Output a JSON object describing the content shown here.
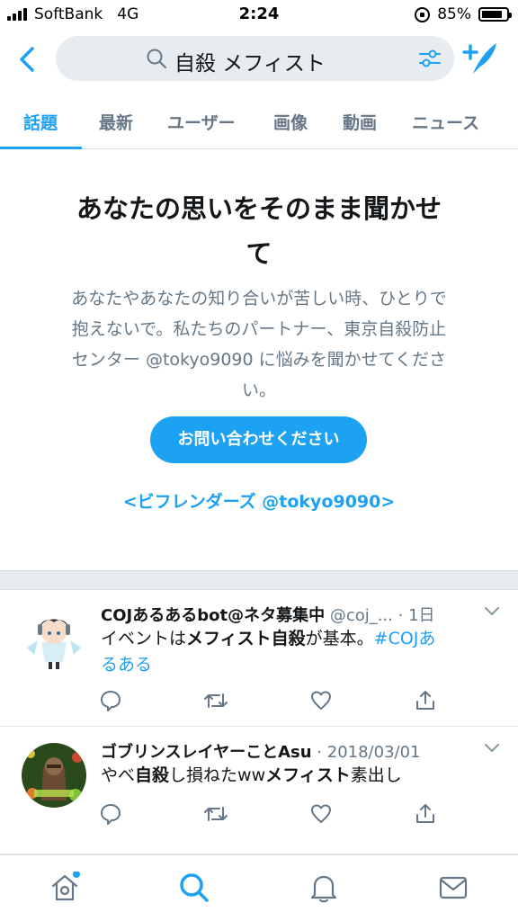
{
  "status_bar": {
    "carrier": "SoftBank",
    "network": "4G",
    "time": "2:24",
    "battery": "85%",
    "battery_level": 0.85
  },
  "search": {
    "query": "自殺 メフィスト",
    "search_icon": "search-icon",
    "filter_icon": "filter-icon"
  },
  "header": {
    "back_icon": "chevron-left-icon",
    "compose_icon": "compose-icon"
  },
  "tabs": [
    {
      "label": "話題",
      "active": true
    },
    {
      "label": "最新",
      "active": false
    },
    {
      "label": "ユーザー",
      "active": false
    },
    {
      "label": "画像",
      "active": false
    },
    {
      "label": "動画",
      "active": false
    },
    {
      "label": "ニュース",
      "active": false
    }
  ],
  "prompt": {
    "title_line1": "あなたの思いをそのまま聞かせ",
    "title_line2": "て",
    "body_line1": "あなたやあなたの知り合いが苦しい時、ひとりで",
    "body_line2": "抱えないで。私たちのパートナー、東京自殺防止",
    "body_line3": "センター @tokyo9090 に悩みを聞かせてくださ",
    "body_line4": "い。",
    "button_label": "お問い合わせください",
    "link_label": "<ビフレンダーズ @tokyo9090>"
  },
  "tweets": [
    {
      "name": "COJあるあるbot@ネタ募集中",
      "handle": "@coj_...",
      "time": "· 1日",
      "text_prefix": "イベントは",
      "text_bold1": "メフィスト自殺",
      "text_middle": "が基本。",
      "hashtag_part1": "#COJあ",
      "hashtag_part2": "るある"
    },
    {
      "name": "ゴブリンスレイヤーことAsu",
      "handle": "",
      "time": "· 2018/03/01",
      "text_prefix": "やべ",
      "text_bold1": "自殺",
      "text_middle": "し損ねたww",
      "text_bold2": "メフィスト",
      "text_suffix": "素出し"
    }
  ],
  "tweet_actions": [
    "reply-icon",
    "retweet-icon",
    "like-icon",
    "share-icon"
  ],
  "bottom_nav": [
    {
      "icon": "home-icon",
      "active": false,
      "badge": true
    },
    {
      "icon": "search-icon",
      "active": true
    },
    {
      "icon": "notifications-icon",
      "active": false
    },
    {
      "icon": "messages-icon",
      "active": false
    }
  ],
  "colors": {
    "accent": "#1da1f2",
    "text_primary": "#14171a",
    "text_secondary": "#657786",
    "divider": "#e6ecf0"
  }
}
